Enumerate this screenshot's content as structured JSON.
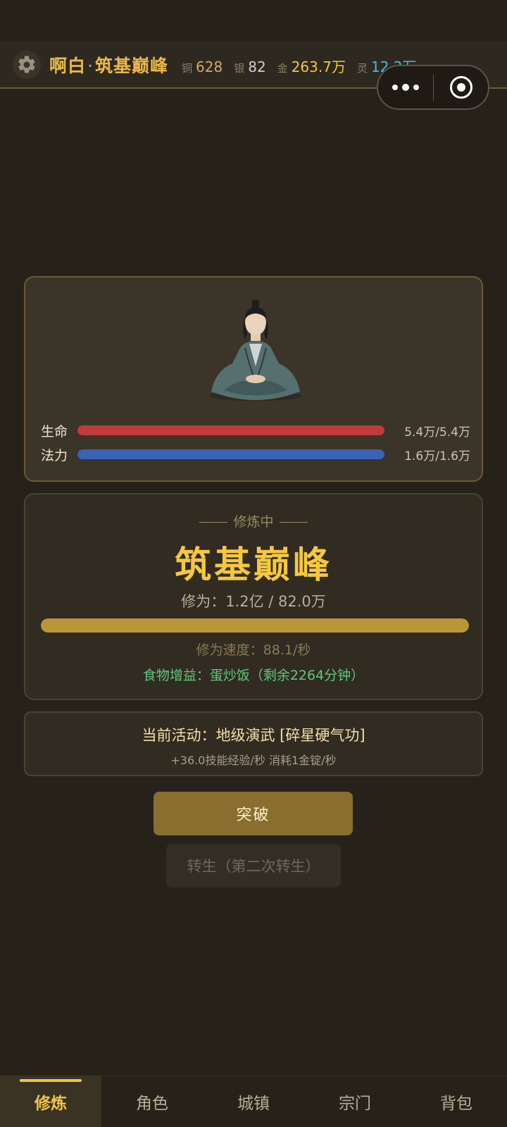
{
  "header": {
    "player_name": "啊白",
    "separator": "·",
    "realm": "筑基巅峰",
    "currencies": [
      {
        "label": "铜",
        "value": "628"
      },
      {
        "label": "银",
        "value": "82"
      },
      {
        "label": "金",
        "value": "263.7万"
      },
      {
        "label": "灵",
        "value": "12.2万"
      }
    ]
  },
  "character": {
    "hp": {
      "label": "生命",
      "value": "5.4万/5.4万",
      "fraction": 1.0
    },
    "mp": {
      "label": "法力",
      "value": "1.6万/1.6万",
      "fraction": 1.0
    }
  },
  "cultivation": {
    "status": "修炼中",
    "realm": "筑基巅峰",
    "progress_text": "修为：1.2亿 / 82.0万",
    "progress_fraction": 1.0,
    "speed_text": "修为速度：88.1/秒",
    "food_text": "食物增益：蛋炒饭（剩余2264分钟）"
  },
  "activity": {
    "title": "当前活动：地级演武 [碎星硬气功]",
    "detail": "+36.0技能经验/秒  消耗1金锭/秒"
  },
  "actions": {
    "breakthrough_label": "突破",
    "rebirth_label": "转生（第二次转生）"
  },
  "nav": {
    "items": [
      "修炼",
      "角色",
      "城镇",
      "宗门",
      "背包"
    ],
    "active_index": 0
  },
  "colors": {
    "background": "#272219",
    "accent_gold": "#f2c548",
    "hp_bar": "#c13b3b",
    "mp_bar": "#3a62b5",
    "progress_bar": "#b8973a",
    "food_green": "#5fc77a"
  },
  "icons": {
    "settings": "gear-icon",
    "capsule_more": "more-dots-icon",
    "capsule_close": "target-close-icon",
    "portrait": "meditating-cultivator-portrait"
  }
}
